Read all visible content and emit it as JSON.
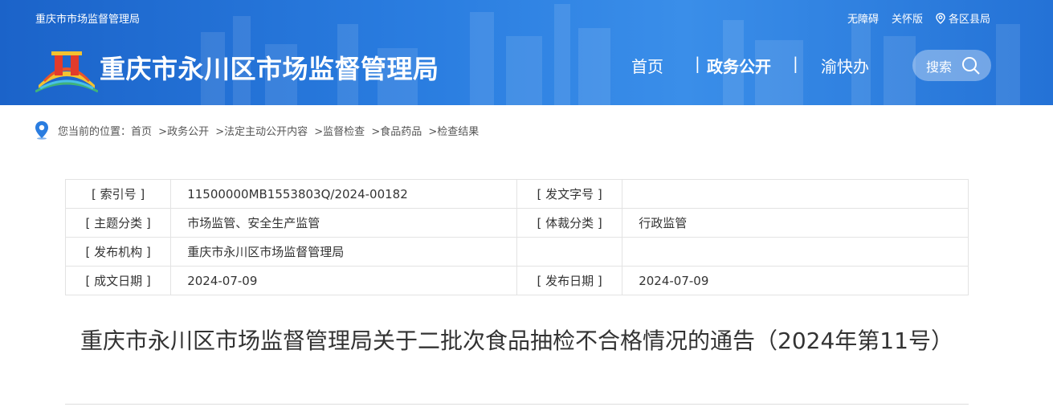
{
  "header": {
    "top_left": "重庆市市场监督管理局",
    "accessibility": "无障碍",
    "elderly": "关怀版",
    "regions": "各区县局",
    "site_title": "重庆市永川区市场监督管理局",
    "nav": {
      "home": "首页",
      "sep": "|",
      "gov": "政务公开",
      "yu": "渝快办"
    },
    "search_label": "搜索"
  },
  "breadcrumb": {
    "prefix": "您当前的位置：",
    "items": [
      "首页",
      ">政务公开",
      ">法定主动公开内容",
      ">监督检查",
      ">食品药品",
      ">检查结果"
    ]
  },
  "info": {
    "rows": [
      [
        "[ 索引号 ]",
        "11500000MB1553803Q/2024-00182",
        "[ 发文字号 ]",
        ""
      ],
      [
        "[ 主题分类 ]",
        "市场监管、安全生产监管",
        "[ 体裁分类 ]",
        "行政监管"
      ],
      [
        "[ 发布机构 ]",
        "重庆市永川区市场监督管理局",
        "",
        ""
      ],
      [
        "[ 成文日期 ]",
        "2024-07-09",
        "[ 发布日期 ]",
        "2024-07-09"
      ]
    ]
  },
  "article": {
    "title": "重庆市永川区市场监督管理局关于二批次食品抽检不合格情况的通告（2024年第11号）"
  },
  "colors": {
    "header_blue": "#1b63c9",
    "border": "#e3e3e3"
  }
}
